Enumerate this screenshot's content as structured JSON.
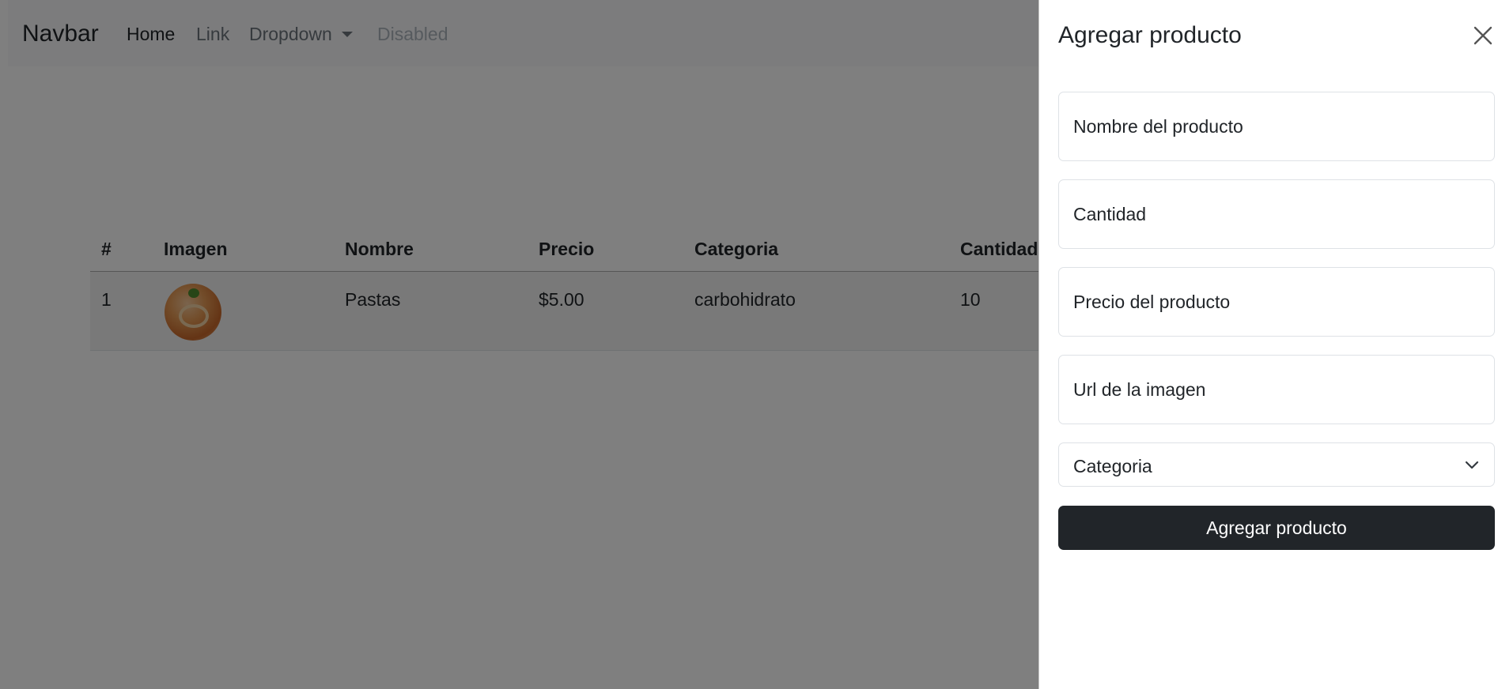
{
  "navbar": {
    "brand": "Navbar",
    "links": {
      "home": "Home",
      "link": "Link",
      "dropdown": "Dropdown",
      "disabled": "Disabled"
    }
  },
  "table": {
    "headers": [
      "#",
      "Imagen",
      "Nombre",
      "Precio",
      "Categoria",
      "Cantidad"
    ],
    "rows": [
      {
        "index": "1",
        "name": "Pastas",
        "price": "$5.00",
        "category": "carbohidrato",
        "quantity": "10"
      }
    ]
  },
  "offcanvas": {
    "title": "Agregar producto",
    "fields": {
      "name_placeholder": "Nombre del producto",
      "quantity_placeholder": "Cantidad",
      "price_placeholder": "Precio del producto",
      "image_url_placeholder": "Url de la imagen"
    },
    "category_select": "Categoria",
    "submit_label": "Agregar producto"
  },
  "colors": {
    "backdrop": "#000000",
    "button_dark": "#212529",
    "navbar_bg": "#f8f9fa"
  },
  "icons": {
    "close": "close-icon",
    "caret": "caret-down-icon",
    "chevron": "chevron-down-icon"
  }
}
